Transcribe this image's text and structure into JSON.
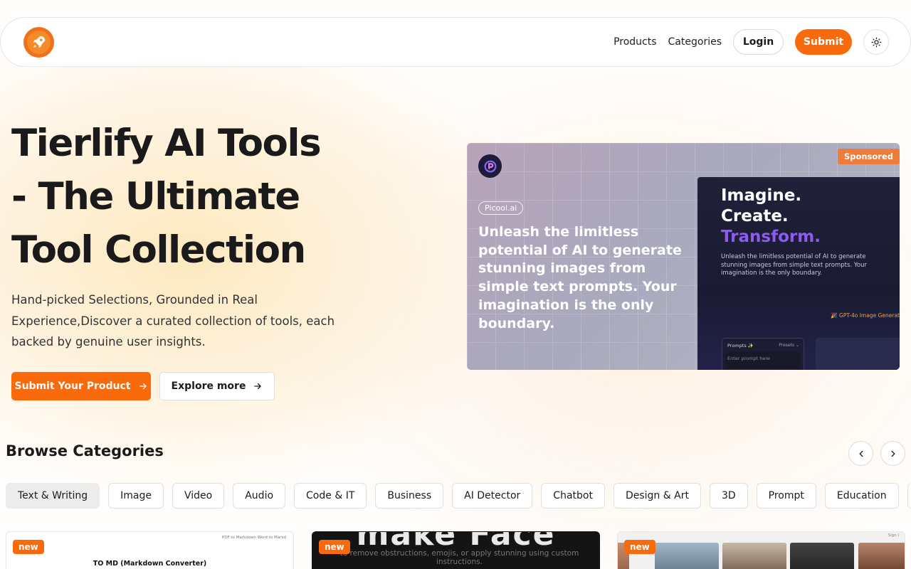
{
  "nav": {
    "products": "Products",
    "categories": "Categories",
    "login": "Login",
    "submit": "Submit"
  },
  "hero": {
    "title_line1": "Tierlify AI Tools",
    "title_line2": "- The Ultimate",
    "title_line3": "Tool Collection",
    "subtitle": "Hand-picked Selections, Grounded in Real Experience,Discover a curated collection of tools, each backed by genuine user insights.",
    "primary_button": "Submit Your Product",
    "secondary_button": "Explore more"
  },
  "ad": {
    "badge": "Sponsored",
    "brand": "Picool.ai",
    "headline": "Unleash the limitless potential of AI to generate stunning images from simple text prompts. Your imagination is the only boundary.",
    "panel_line1": "Imagine.",
    "panel_line2": "Create.",
    "panel_line3": "Transform.",
    "panel_text": "Unleash the limitless potential of AI to generate stunning images from simple text prompts. Your imagination is the only boundary.",
    "panel_tag": "🎉 GPT-4o Image Generat",
    "prompt_label": "Prompts ✨",
    "prompt_presets": "Presets ⌄",
    "prompt_placeholder": "Enter prompt here"
  },
  "categories": {
    "title": "Browse Categories",
    "tabs": [
      "Text & Writing",
      "Image",
      "Video",
      "Audio",
      "Code & IT",
      "Business",
      "AI Detector",
      "Chatbot",
      "Design & Art",
      "3D",
      "Prompt",
      "Education",
      "Li"
    ],
    "active_index": 0
  },
  "cards": [
    {
      "badge": "new",
      "top_text": "PDF to Markdown      Word to Markd",
      "title": "TO MD (Markdown Converter)"
    },
    {
      "badge": "new",
      "big_text": "make Face",
      "small_text": "to remove obstructions, emojis, or apply stunning using custom instructions."
    },
    {
      "badge": "new",
      "top_text": "Sign I"
    }
  ],
  "colors": {
    "accent": "#f86a0b",
    "ad_badge": "#ee7c3a",
    "purple": "#8a5cf0"
  },
  "icons": [
    "rocket-icon",
    "sun-icon",
    "arrow-right-icon",
    "chevron-left-icon",
    "chevron-right-icon",
    "picool-logo-icon"
  ]
}
